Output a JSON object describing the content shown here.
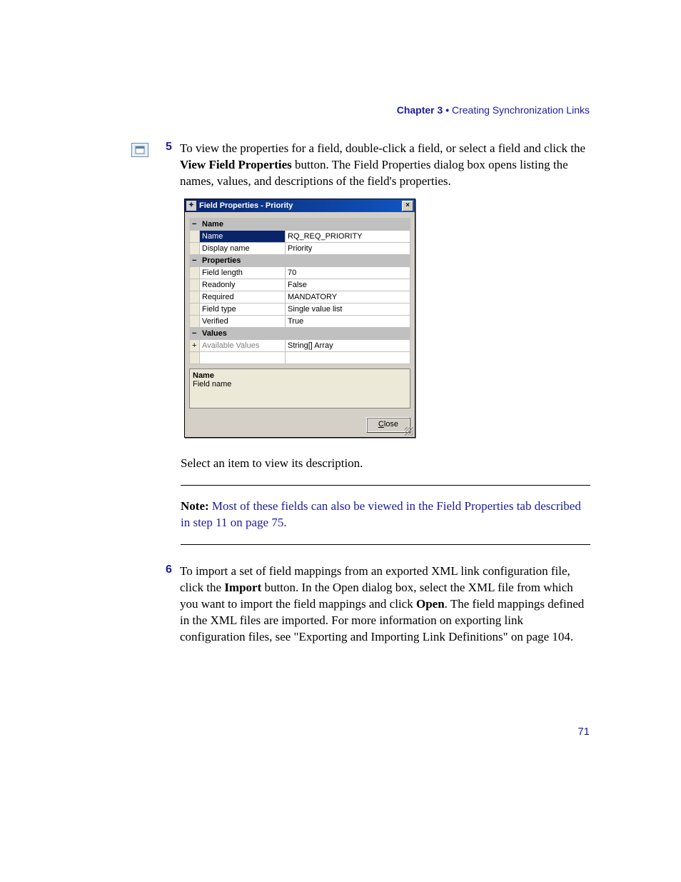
{
  "header": {
    "chapter": "Chapter 3 •",
    "title": " Creating Synchronization Links"
  },
  "step5": {
    "number": "5",
    "text_before_bold": "To view the properties for a field, double-click a field, or select a field and click the ",
    "bold": "View Field Properties",
    "text_after_bold": " button. The Field Properties dialog box opens listing the names, values, and descriptions of the field's properties."
  },
  "dialog": {
    "title": "Field Properties - Priority",
    "sections": {
      "name": {
        "header": "Name",
        "rows": [
          {
            "key": "Name",
            "value": "RQ_REQ_PRIORITY",
            "selected": true
          },
          {
            "key": "Display name",
            "value": "Priority"
          }
        ]
      },
      "properties": {
        "header": "Properties",
        "rows": [
          {
            "key": "Field length",
            "value": "70"
          },
          {
            "key": "Readonly",
            "value": "False"
          },
          {
            "key": "Required",
            "value": "MANDATORY"
          },
          {
            "key": "Field type",
            "value": "Single value list"
          },
          {
            "key": "Verified",
            "value": "True"
          }
        ]
      },
      "values": {
        "header": "Values",
        "rows": [
          {
            "key": "Available Values",
            "value": "String[] Array",
            "expander": "+"
          }
        ]
      }
    },
    "description": {
      "name": "Name",
      "text": "Field name"
    },
    "close_prefix": "C",
    "close_suffix": "lose"
  },
  "after_dialog": "Select an item to view its description.",
  "note": {
    "label": "Note:",
    "link_text": " Most of these fields can also be viewed in the Field Properties tab described in step 11 on page 75."
  },
  "step6": {
    "number": "6",
    "p1": "To import a set of field mappings from an exported XML link configuration file, click the ",
    "b1": "Import",
    "p2": " button. In the Open dialog box, select the XML file from which you want to import the field mappings and click ",
    "b2": "Open",
    "p3": ". The field mappings defined in the XML files are imported. For more information on exporting link configuration files, see \"Exporting and Importing Link Definitions\" on page 104."
  },
  "page_number": "71"
}
